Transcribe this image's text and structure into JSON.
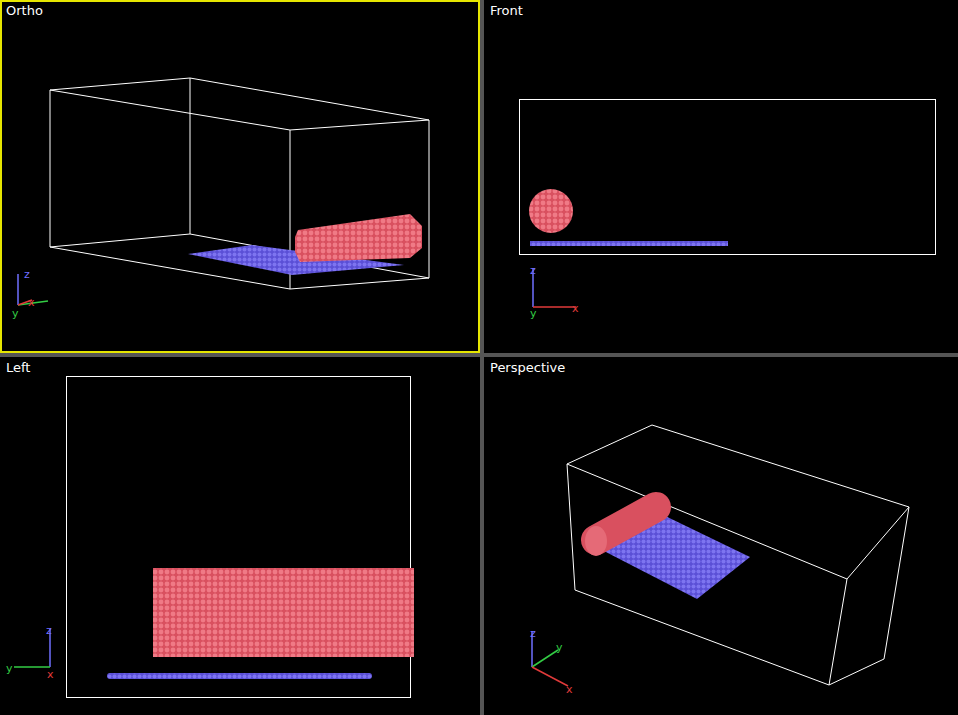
{
  "viewports": [
    {
      "title": "Ortho",
      "kind": "ortho",
      "selected": true,
      "axes": [
        {
          "label": "z",
          "color": "#6f6fff"
        },
        {
          "label": "y",
          "color": "#33cc44"
        },
        {
          "label": "x",
          "color": "#e03a3a"
        }
      ]
    },
    {
      "title": "Front",
      "kind": "front",
      "selected": false,
      "axes": [
        {
          "label": "z",
          "color": "#6f6fff"
        },
        {
          "label": "y",
          "color": "#33cc44"
        },
        {
          "label": "x",
          "color": "#e03a3a"
        }
      ]
    },
    {
      "title": "Left",
      "kind": "left",
      "selected": false,
      "axes": [
        {
          "label": "z",
          "color": "#6f6fff"
        },
        {
          "label": "y",
          "color": "#33cc44"
        },
        {
          "label": "x",
          "color": "#e03a3a"
        }
      ]
    },
    {
      "title": "Perspective",
      "kind": "perspective",
      "selected": false,
      "axes": [
        {
          "label": "z",
          "color": "#6f6fff"
        },
        {
          "label": "y",
          "color": "#33cc44"
        },
        {
          "label": "x",
          "color": "#e03a3a"
        }
      ]
    }
  ]
}
